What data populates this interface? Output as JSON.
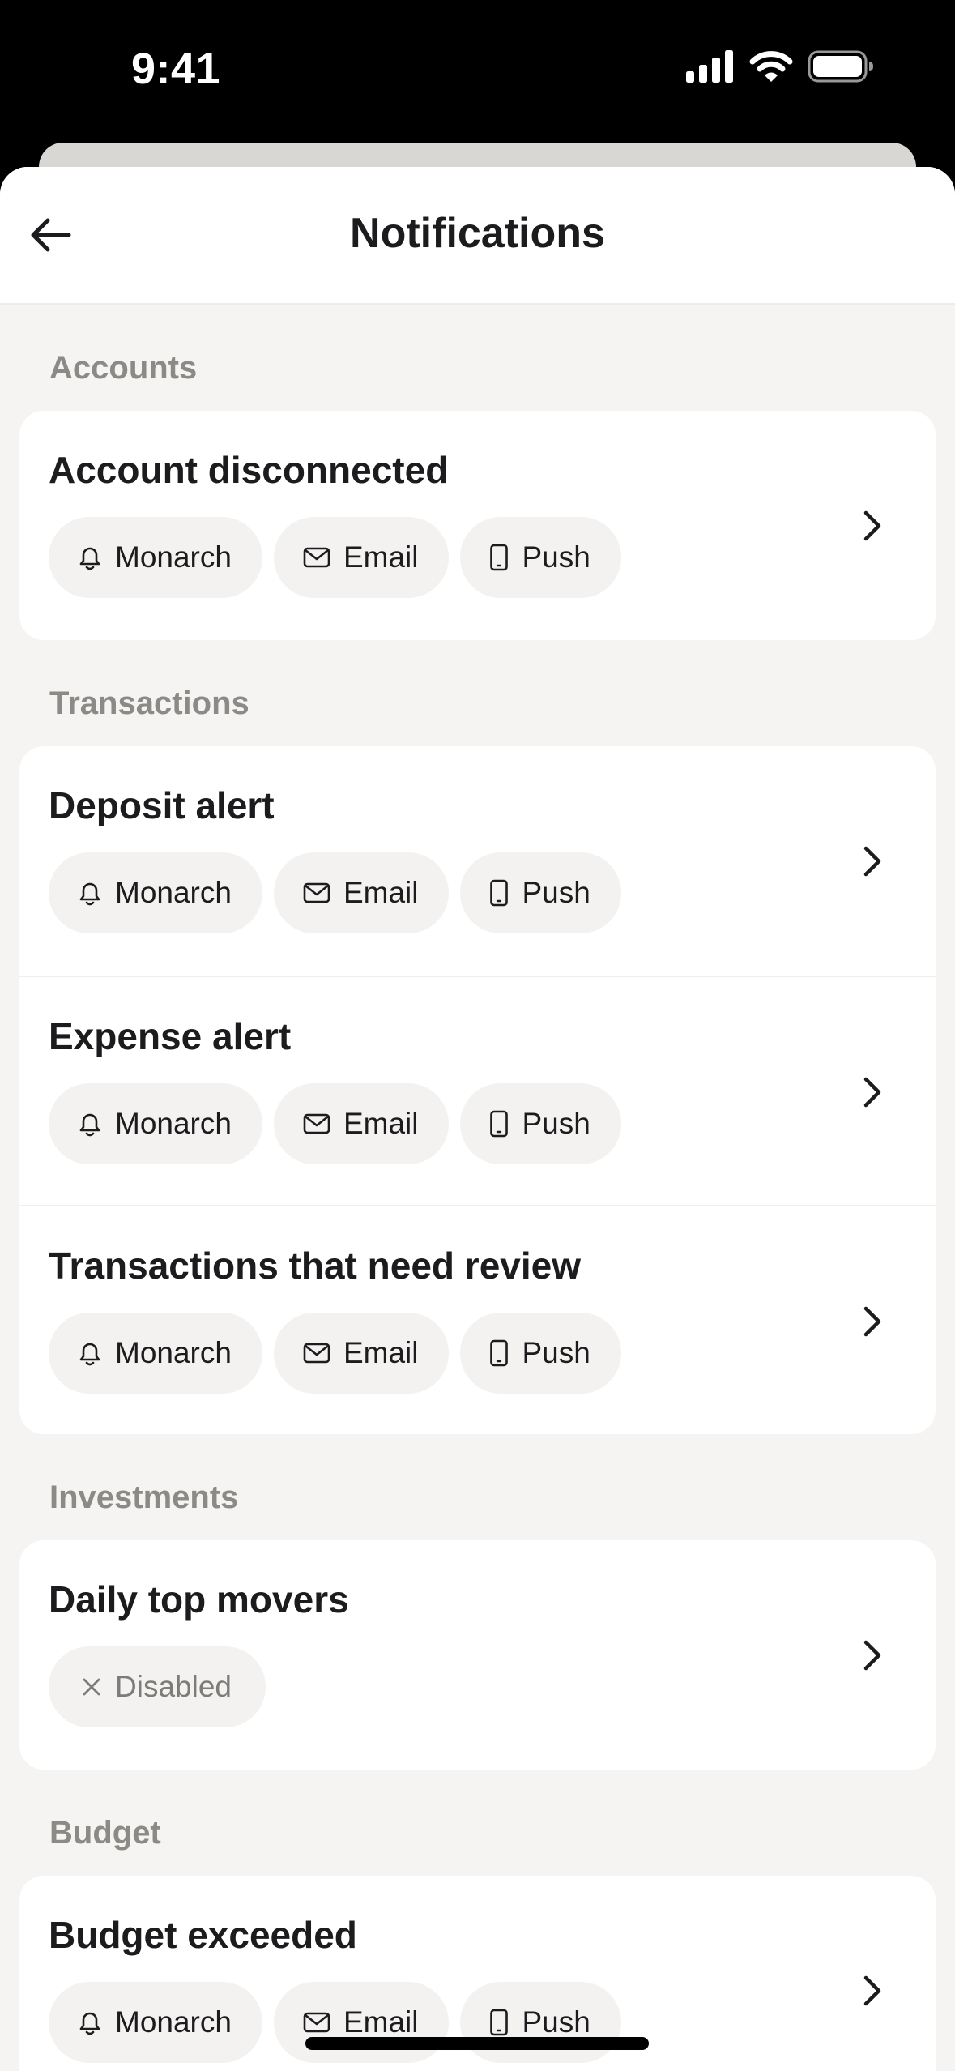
{
  "status_bar": {
    "time": "9:41"
  },
  "header": {
    "title": "Notifications"
  },
  "sections": [
    {
      "title": "Accounts",
      "items": [
        {
          "title": "Account disconnected",
          "channels": [
            "Monarch",
            "Email",
            "Push"
          ]
        }
      ]
    },
    {
      "title": "Transactions",
      "items": [
        {
          "title": "Deposit alert",
          "channels": [
            "Monarch",
            "Email",
            "Push"
          ]
        },
        {
          "title": "Expense alert",
          "channels": [
            "Monarch",
            "Email",
            "Push"
          ]
        },
        {
          "title": "Transactions that need review",
          "channels": [
            "Monarch",
            "Email",
            "Push"
          ]
        }
      ]
    },
    {
      "title": "Investments",
      "items": [
        {
          "title": "Daily top movers",
          "disabled_label": "Disabled"
        }
      ]
    },
    {
      "title": "Budget",
      "items": [
        {
          "title": "Budget exceeded",
          "channels": [
            "Monarch",
            "Email",
            "Push"
          ]
        }
      ]
    }
  ],
  "icons": {
    "monarch": "bell-icon",
    "email": "mail-icon",
    "push": "phone-icon",
    "disabled": "x-icon",
    "row": "chevron-right-icon",
    "back": "arrow-left-icon"
  },
  "colors": {
    "background": "#f5f4f2",
    "card": "#ffffff",
    "chip": "#f3f2f0",
    "section_title": "#8b8a87",
    "text": "#1c1c1e"
  }
}
